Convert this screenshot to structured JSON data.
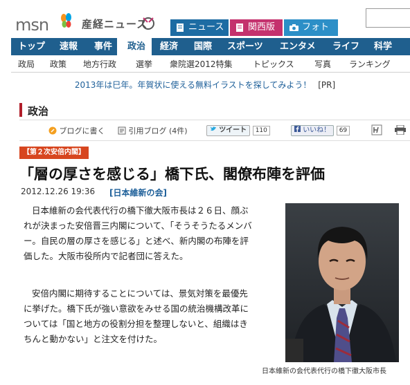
{
  "header": {
    "logo": "msn",
    "site_name": "産経ニュース",
    "tabs": [
      {
        "label": "ニュース",
        "color": "#1d6ca3"
      },
      {
        "label": "関西版",
        "color": "#c4316d"
      },
      {
        "label": "フォト",
        "color": "#2c8fc7"
      }
    ]
  },
  "main_nav": [
    "トップ",
    "速報",
    "事件",
    "政治",
    "経済",
    "国際",
    "スポーツ",
    "エンタメ",
    "ライフ",
    "科学"
  ],
  "main_nav_active": "政治",
  "sub_nav": [
    "政局",
    "政策",
    "地方行政",
    "選挙",
    "衆院選2012特集",
    "トピックス",
    "写真",
    "ランキング"
  ],
  "ad": {
    "text": "2013年は巳年。年賀状に使える無料イラストを探してみよう！",
    "tag": "[PR]"
  },
  "section": {
    "title": "政治"
  },
  "social": {
    "blog_label": "ブログに書く",
    "quote_label": "引用ブログ",
    "quote_count": "(4件)",
    "tweet_label": "ツイート",
    "tweet_count": "110",
    "like_label": "いいね！",
    "like_count": "69"
  },
  "article": {
    "category_tag": "【第２次安倍内閣】",
    "headline": "「層の厚さを感じる」橋下氏、閣僚布陣を評価",
    "date": "2012.12.26 19:36",
    "category_link": "[日本維新の会]",
    "paragraphs": [
      "日本維新の会代表代行の橋下徹大阪市長は２６日、顔ぶれが決まった安倍晋三内閣について、「そうそうたるメンバー。自民の層の厚さを感じる」と述べ、新内閣の布陣を評価した。大阪市役所内で記者団に答えた。",
      "安倍内閣に期待することについては、景気対策を最優先に挙げた。橋下氏が強い意欲をみせる国の統治機構改革については「国と地方の役割分担を整理しないと、組織はきちんと動かない」と注文を付けた。"
    ],
    "photo_caption": "日本維新の会代表代行の橋下徹大阪市長"
  },
  "colors": {
    "nav_bg": "#1f5f8e",
    "accent_red": "#b11e2a",
    "tag_orange": "#d7461f",
    "link_blue": "#1d5f99"
  }
}
